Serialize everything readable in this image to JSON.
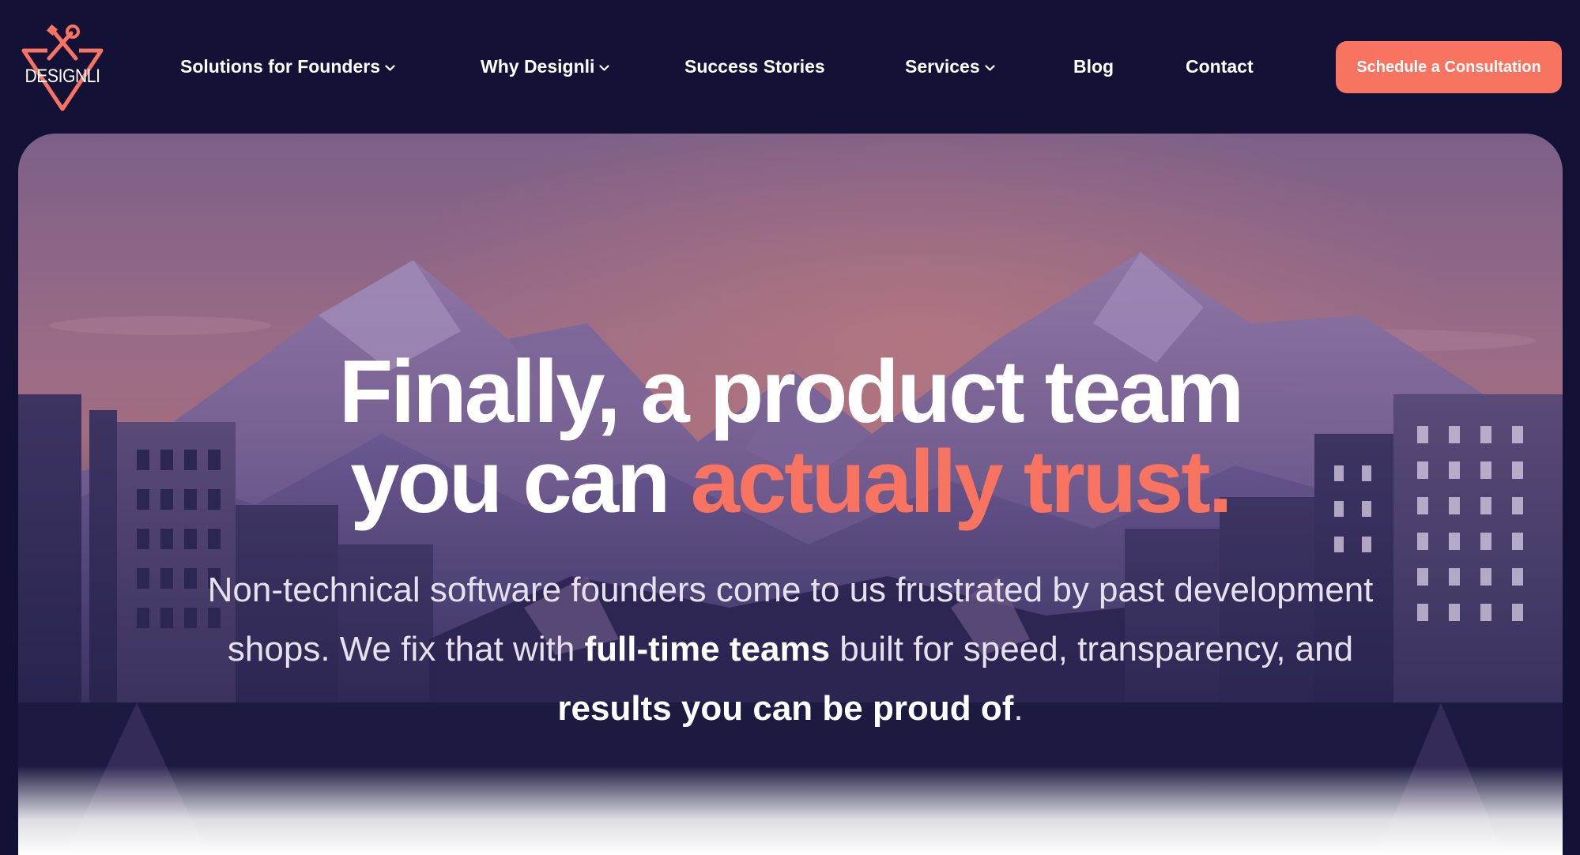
{
  "brand": {
    "name": "DESIGNLI",
    "accent_color": "#f87461",
    "background_color": "#131236"
  },
  "nav": {
    "items": [
      {
        "label": "Solutions for Founders",
        "has_dropdown": true
      },
      {
        "label": "Why Designli",
        "has_dropdown": true
      },
      {
        "label": "Success Stories",
        "has_dropdown": false
      },
      {
        "label": "Services",
        "has_dropdown": true
      },
      {
        "label": "Blog",
        "has_dropdown": false
      },
      {
        "label": "Contact",
        "has_dropdown": false
      }
    ],
    "cta_label": "Schedule a Consultation"
  },
  "hero": {
    "headline_line1": "Finally, a product team",
    "headline_line2_plain": "you can ",
    "headline_line2_accent": "actually trust.",
    "sub_part1": "Non-technical software founders come to us frustrated by past development shops. We fix that with ",
    "sub_bold1": "full-time teams",
    "sub_part2": " built for speed, transparency, and ",
    "sub_bold2": "results you can be proud of",
    "sub_part3": "."
  },
  "icons": {
    "logo": "wrench-and-screwdriver-triangle-logo",
    "dropdown": "chevron-down-icon"
  }
}
